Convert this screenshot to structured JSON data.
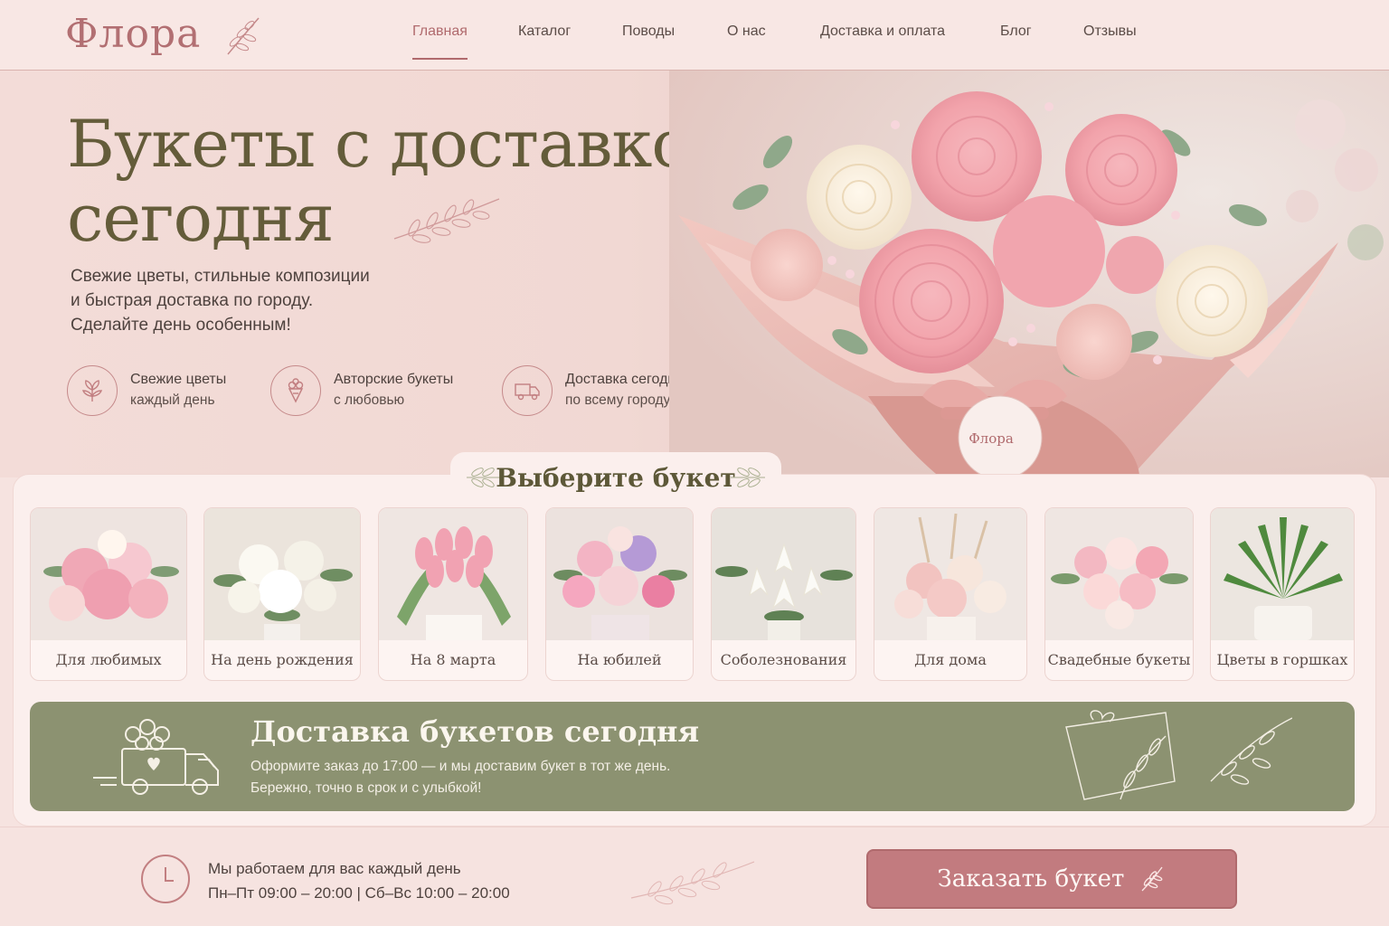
{
  "brand": {
    "logo_text": "Флора"
  },
  "nav": {
    "items": [
      {
        "label": "Главная",
        "active": true
      },
      {
        "label": "Каталог"
      },
      {
        "label": "Поводы"
      },
      {
        "label": "О нас"
      },
      {
        "label": "Доставка и оплата"
      },
      {
        "label": "Блог"
      },
      {
        "label": "Отзывы"
      }
    ]
  },
  "hero": {
    "title_line1": "Букеты с доставкой",
    "title_line2": "сегодня",
    "subtitle_lines": [
      "Свежие цветы, стильные композиции",
      "и быстрая доставка по городу.",
      "Сделайте день особенным!"
    ],
    "tag_text": "Флора",
    "features": [
      {
        "icon": "leaf-icon",
        "line1": "Свежие цветы",
        "line2": "каждый день"
      },
      {
        "icon": "bouquet-icon",
        "line1": "Авторские букеты",
        "line2": "с любовью"
      },
      {
        "icon": "truck-icon",
        "line1": "Доставка сегодня",
        "line2": "по всему городу"
      }
    ]
  },
  "catalog": {
    "title": "Выберите букет",
    "cards": [
      {
        "label": "Для любимых"
      },
      {
        "label": "На день рождения"
      },
      {
        "label": "На 8 марта"
      },
      {
        "label": "На юбилей"
      },
      {
        "label": "Соболезнования"
      },
      {
        "label": "Для дома"
      },
      {
        "label": "Свадебные букеты"
      },
      {
        "label": "Цветы в горшках"
      }
    ]
  },
  "delivery_banner": {
    "title": "Доставка букетов сегодня",
    "line1": "Оформите заказ до 17:00 — и мы доставим букет в тот же день.",
    "line2": "Бережно, точно в срок и с улыбкой!"
  },
  "footer": {
    "hours_title": "Мы работаем для вас каждый день",
    "hours_schedule": "Пн–Пт  09:00 – 20:00   |   Сб–Вс  10:00 – 20:00",
    "order_button": "Заказать букет"
  },
  "colors": {
    "accent": "#b06a6d",
    "olive_title": "#645c3a",
    "banner_green": "#8c9271",
    "button": "#c27b7f",
    "background": "#f6e3e0"
  }
}
